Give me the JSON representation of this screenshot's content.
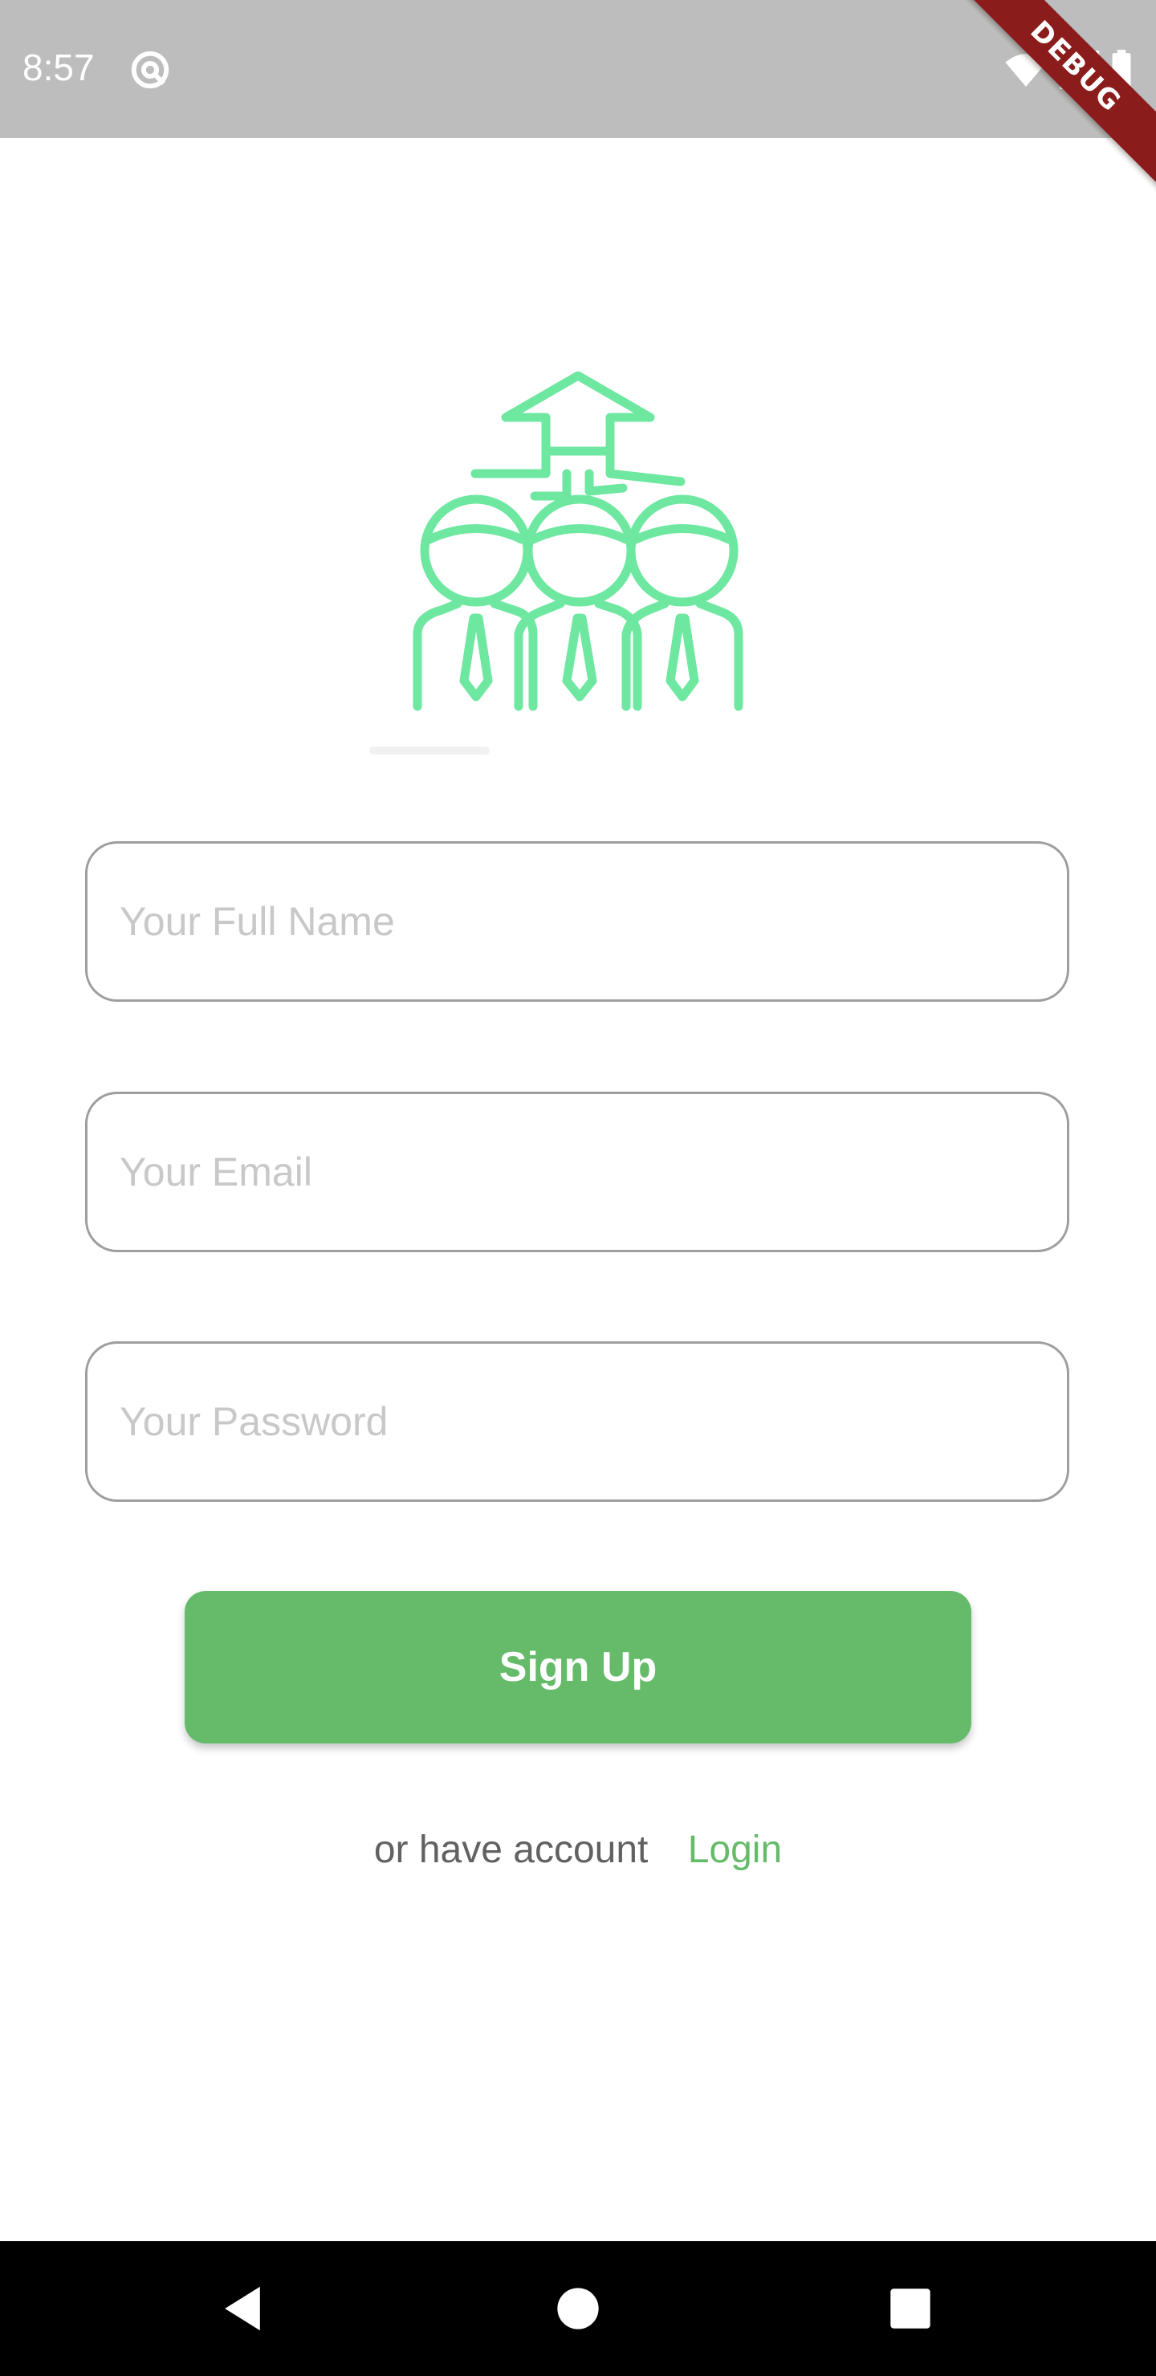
{
  "status_bar": {
    "time": "8:57",
    "app_icon": "at-sign-icon",
    "wifi_icon": "wifi-icon",
    "signal_icon": "cell-signal-icon",
    "battery_icon": "battery-icon",
    "debug_label": "DEBUG",
    "debug_color": "#8b1c1c"
  },
  "logo": {
    "icon": "team-growth-icon",
    "color": "#6ee7a0"
  },
  "form": {
    "full_name": {
      "placeholder": "Your Full Name",
      "value": ""
    },
    "email": {
      "placeholder": "Your Email",
      "value": ""
    },
    "password": {
      "placeholder": "Your Password",
      "value": ""
    }
  },
  "signup_button": {
    "label": "Sign Up",
    "color": "#66bb6a"
  },
  "login_row": {
    "prompt": "or have account",
    "link_label": "Login",
    "link_color": "#66bb6a"
  },
  "nav_bar": {
    "back_icon": "back-triangle-icon",
    "home_icon": "home-circle-icon",
    "recents_icon": "recents-square-icon"
  }
}
